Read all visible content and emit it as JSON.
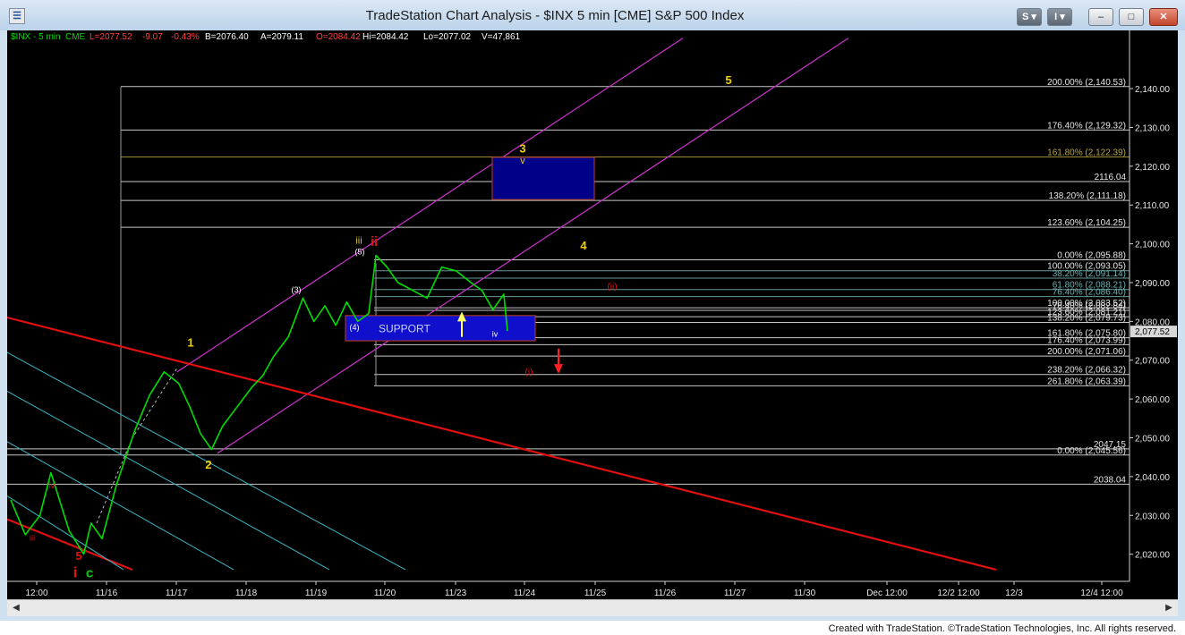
{
  "window": {
    "title": "TradeStation Chart Analysis - $INX 5 min [CME] S&P 500 Index",
    "btn_s": "S",
    "btn_i": "I",
    "minimize": "–",
    "maximize": "□",
    "close": "✕"
  },
  "colors": {
    "background": "#000000",
    "price": "#00dd00",
    "channel": "#cc33cc",
    "trendline": "#e01010",
    "fib": "#c8c8c8",
    "support_box": "#1010cc",
    "target_box": "#000088",
    "wave_yellow": "#f0d000",
    "wave_red": "#e01010"
  },
  "status": {
    "symbol": "$INX - 5 min",
    "exchange": "CME",
    "last": "L=2077.52",
    "change": "-9.07",
    "pct": "-0.43%",
    "bid": "B=2076.40",
    "ask": "A=2079.11",
    "open": "O=2084.42",
    "high": "Hi=2084.42",
    "low": "Lo=2077.02",
    "volume": "V=47,861"
  },
  "footer": "Created with TradeStation. ©TradeStation Technologies, Inc. All rights reserved.",
  "chart_data": {
    "type": "line",
    "title": "$INX 5 min [CME] S&P 500 Index",
    "y_ticks": [
      "2,140.00",
      "2,130.00",
      "2,120.00",
      "2,110.00",
      "2,100.00",
      "2,090.00",
      "2,080.00",
      "2,070.00",
      "2,060.00",
      "2,050.00",
      "2,040.00",
      "2,030.00",
      "2,020.00"
    ],
    "ylim": [
      2013,
      2155
    ],
    "last_price_label": "2,077.52",
    "x_ticks": [
      "12:00",
      "11/16",
      "11/17",
      "11/18",
      "11/19",
      "11/20",
      "11/23",
      "11/24",
      "11/25",
      "11/26",
      "11/27",
      "11/30",
      "Dec 12:00",
      "12/2 12:00",
      "12/3",
      "12/4 12:00"
    ],
    "price_series": [
      [
        0,
        2034
      ],
      [
        0.2,
        2025
      ],
      [
        0.4,
        2030
      ],
      [
        0.55,
        2041
      ],
      [
        0.8,
        2026
      ],
      [
        1.0,
        2020
      ],
      [
        1.1,
        2028
      ],
      [
        1.25,
        2024
      ],
      [
        1.45,
        2038
      ],
      [
        1.7,
        2052
      ],
      [
        1.9,
        2061
      ],
      [
        2.1,
        2067
      ],
      [
        2.3,
        2064
      ],
      [
        2.45,
        2058
      ],
      [
        2.6,
        2051
      ],
      [
        2.75,
        2047
      ],
      [
        2.9,
        2053
      ],
      [
        3.1,
        2058
      ],
      [
        3.3,
        2063
      ],
      [
        3.45,
        2066
      ],
      [
        3.6,
        2071
      ],
      [
        3.8,
        2076
      ],
      [
        4.0,
        2086
      ],
      [
        4.15,
        2080
      ],
      [
        4.3,
        2084
      ],
      [
        4.45,
        2079
      ],
      [
        4.6,
        2085
      ],
      [
        4.75,
        2080
      ],
      [
        4.9,
        2082
      ],
      [
        5.0,
        2097
      ],
      [
        5.15,
        2094
      ],
      [
        5.3,
        2090
      ],
      [
        5.5,
        2088
      ],
      [
        5.7,
        2086
      ],
      [
        5.9,
        2094
      ],
      [
        6.1,
        2093
      ],
      [
        6.3,
        2090
      ],
      [
        6.45,
        2088
      ],
      [
        6.6,
        2083
      ],
      [
        6.75,
        2087
      ],
      [
        6.8,
        2077.52
      ]
    ],
    "fib_levels": [
      {
        "label": "200.00% (2,140.53)",
        "value": 2140.53
      },
      {
        "label": "176.40% (2,129.32)",
        "value": 2129.32
      },
      {
        "label": "161.80% (2,122.39)",
        "value": 2122.39
      },
      {
        "label": "2116.04",
        "value": 2116.04
      },
      {
        "label": "138.20% (2,111.18)",
        "value": 2111.18
      },
      {
        "label": "123.60% (2,104.25)",
        "value": 2104.25
      },
      {
        "label": "0.00% (2,095.88)",
        "value": 2095.88
      },
      {
        "label": "100.00% (2,093.05)",
        "value": 2093.05
      },
      {
        "label": "38.20% (2,091.14)",
        "value": 2091.14
      },
      {
        "label": "61.80% (2,088.21)",
        "value": 2088.21
      },
      {
        "label": "76.40% (2,086.40)",
        "value": 2086.4
      },
      {
        "label": "100.00% (2,083.52)",
        "value": 2083.52
      },
      {
        "label": "76.40% (2,082.84)",
        "value": 2082.84
      },
      {
        "label": "123.60% (2,081.21)",
        "value": 2081.21
      },
      {
        "label": "138.20% (2,079.73)",
        "value": 2079.73
      },
      {
        "label": "161.80% (2,075.80)",
        "value": 2075.8
      },
      {
        "label": "176.40% (2,073.99)",
        "value": 2073.99
      },
      {
        "label": "200.00% (2,071.06)",
        "value": 2071.06
      },
      {
        "label": "238.20% (2,066.32)",
        "value": 2066.32
      },
      {
        "label": "261.80% (2,063.39)",
        "value": 2063.39
      },
      {
        "label": "2047.15",
        "value": 2047.15
      },
      {
        "label": "0.00% (2,045.56)",
        "value": 2045.56
      },
      {
        "label": "2038.04",
        "value": 2038.04
      }
    ],
    "annotations": {
      "support": "SUPPORT",
      "w1": "1",
      "w2": "2",
      "w3": "3",
      "w3v": "v",
      "w4": "4",
      "w5": "5",
      "iii_top": "iii",
      "ii_top": "ii",
      "p5": "(5)",
      "p3": "(3)",
      "p4": "(4)",
      "iv": "iv",
      "iv_bottom": "iv",
      "iii_bottom": "iii",
      "i_bottom": "i",
      "five_bottom": "5",
      "c_bottom": "c",
      "ii_red": "(ii)",
      "i_red": "(i)"
    }
  }
}
